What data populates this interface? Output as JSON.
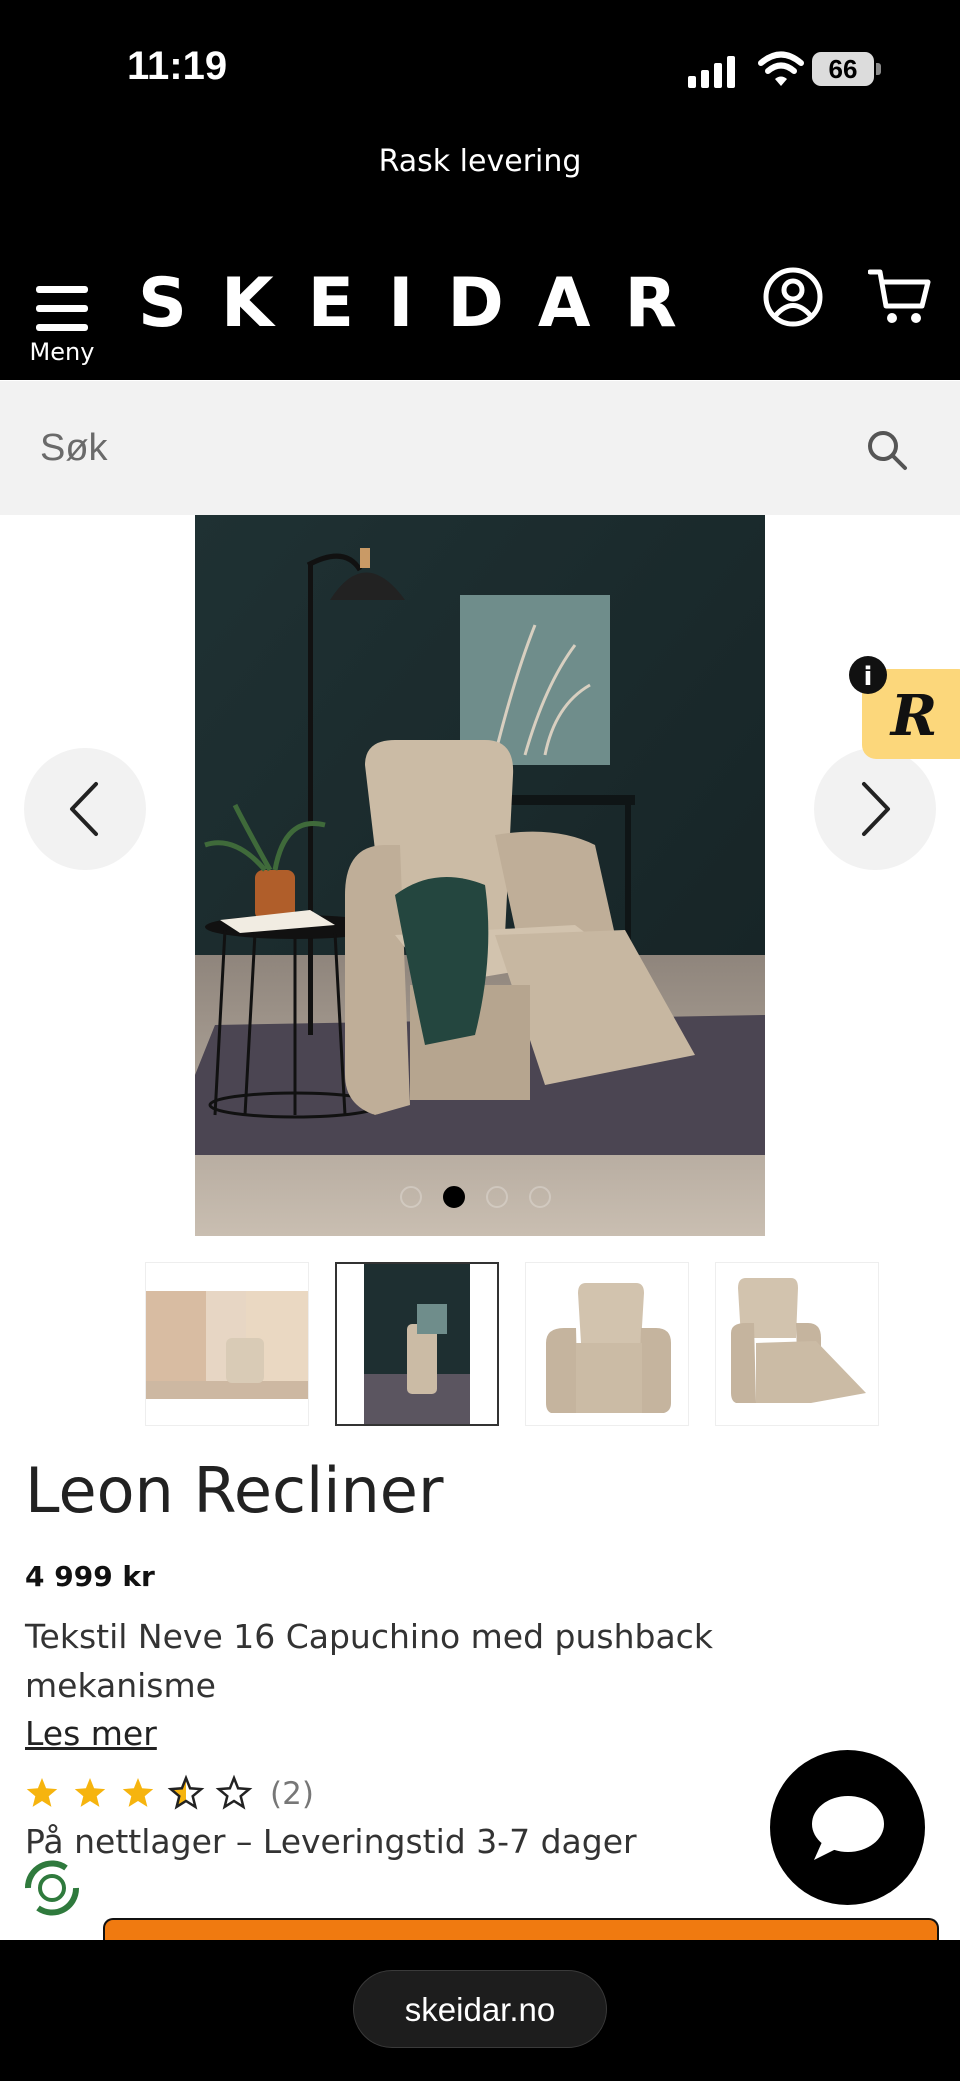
{
  "status_bar": {
    "time": "11:19",
    "battery": "66"
  },
  "promo": {
    "text": "Rask levering"
  },
  "header": {
    "menu_label": "Meny",
    "logo": "SKEIDAR"
  },
  "search": {
    "placeholder": "Søk"
  },
  "gallery": {
    "slide_count": 4,
    "active_index": 1
  },
  "product": {
    "title": "Leon Recliner",
    "price": "4 999 kr",
    "description": "Tekstil Neve 16 Capuchino med pushback mekanisme",
    "read_more": "Les mer",
    "rating": 3.5,
    "rating_max": 5,
    "review_count": "(2)",
    "availability": "På nettlager – Leveringstid 3-7 dager"
  },
  "browser": {
    "url": "skeidar.no"
  },
  "colors": {
    "accent": "#f07a10",
    "widget_yellow": "#fcd77b",
    "star": "#f6b40e"
  }
}
